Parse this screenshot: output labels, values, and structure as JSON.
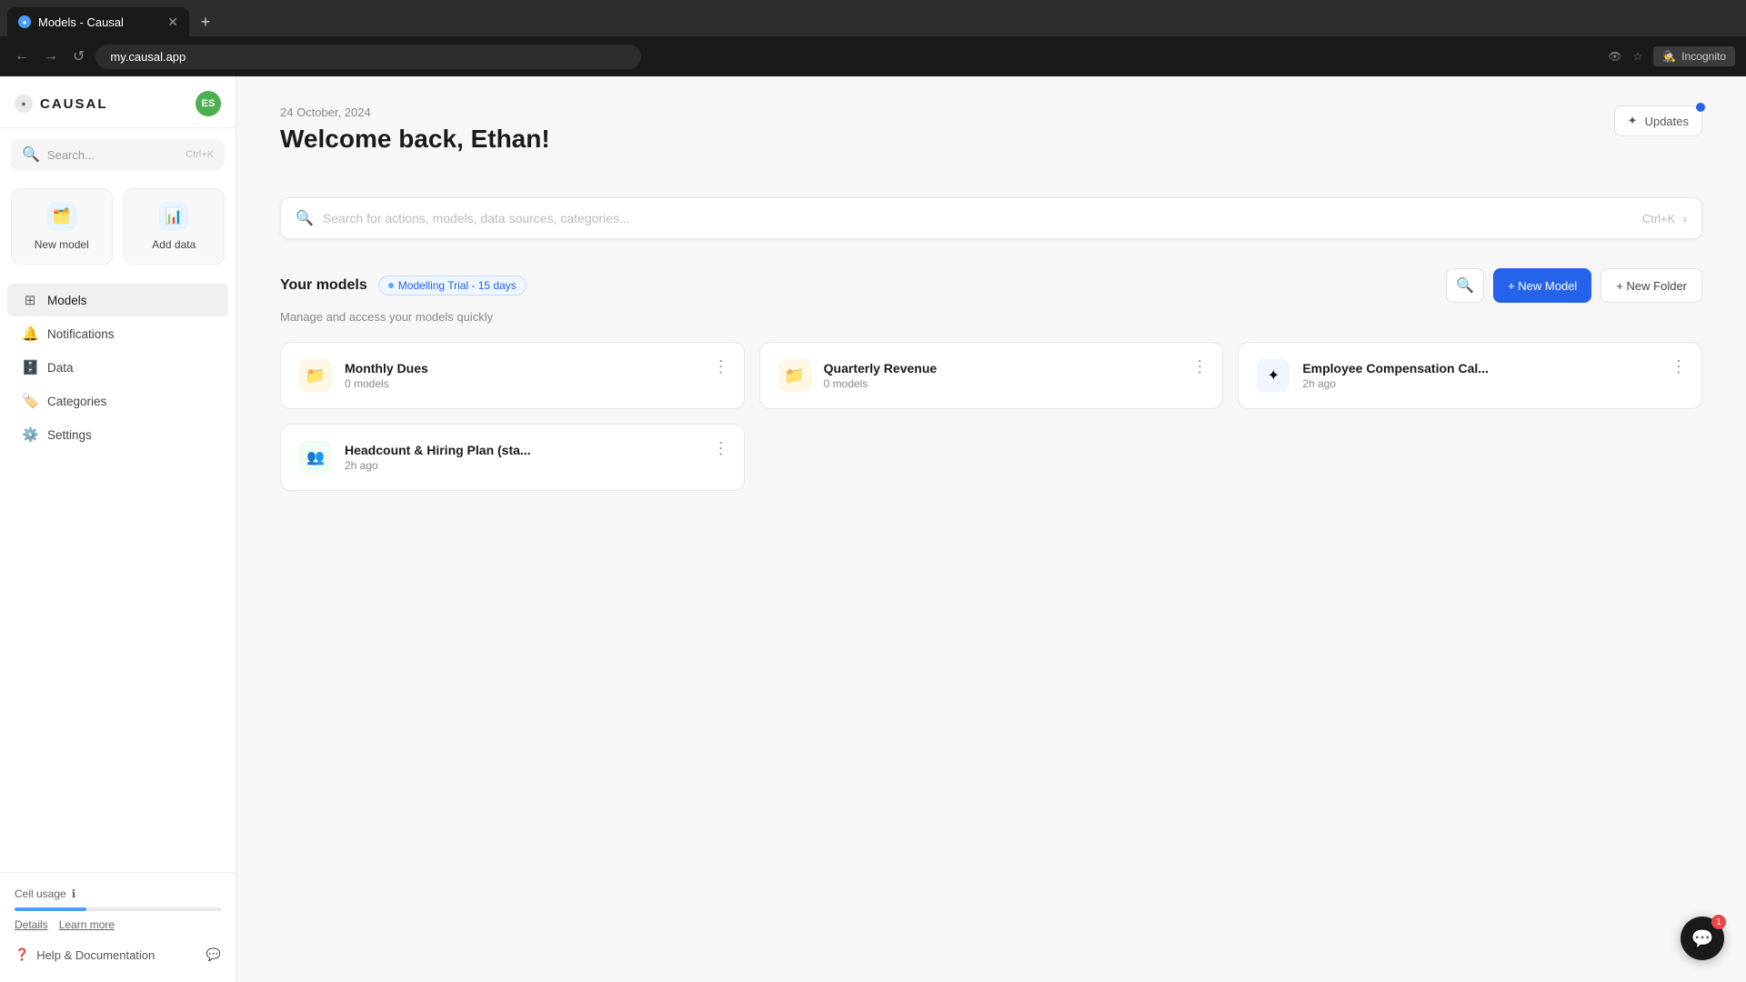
{
  "browser": {
    "tab_label": "Models - Causal",
    "url": "my.causal.app",
    "incognito": "Incognito"
  },
  "sidebar": {
    "logo": "CAUSAL",
    "avatar_initials": "ES",
    "search_placeholder": "Search...",
    "search_shortcut": "Ctrl+K",
    "quick_actions": [
      {
        "label": "New model",
        "icon": "🗂️"
      },
      {
        "label": "Add data",
        "icon": "📊"
      }
    ],
    "nav_items": [
      {
        "label": "Models",
        "icon": "⊞",
        "active": true
      },
      {
        "label": "Notifications",
        "icon": "🔔",
        "active": false
      },
      {
        "label": "Data",
        "icon": "🗄️",
        "active": false
      },
      {
        "label": "Categories",
        "icon": "🏷️",
        "active": false
      },
      {
        "label": "Settings",
        "icon": "⚙️",
        "active": false
      }
    ],
    "cell_usage_label": "Cell usage",
    "details_link": "Details",
    "learn_more_link": "Learn more",
    "help_label": "Help & Documentation"
  },
  "header": {
    "date": "24 October, 2024",
    "welcome": "Welcome back, Ethan!",
    "updates_label": "Updates"
  },
  "search": {
    "placeholder": "Search for actions, models, data sources, categories...",
    "shortcut": "Ctrl+K"
  },
  "models_section": {
    "title": "Your models",
    "trial_label": "Modelling Trial - 15 days",
    "subtitle": "Manage and access your models quickly",
    "new_model_btn": "+ New Model",
    "new_folder_btn": "+ New Folder"
  },
  "model_cards": [
    {
      "type": "folder",
      "name": "Monthly Dues",
      "count": "0 models",
      "icon": "📁"
    },
    {
      "type": "folder",
      "name": "Quarterly Revenue",
      "count": "0 models",
      "icon": "📁"
    },
    {
      "type": "model",
      "name": "Employee Compensation Cal...",
      "time": "2h ago",
      "icon": "✦"
    },
    {
      "type": "model",
      "name": "Headcount & Hiring Plan (sta...",
      "time": "2h ago",
      "icon": "👥"
    }
  ],
  "chat": {
    "badge": "1"
  }
}
